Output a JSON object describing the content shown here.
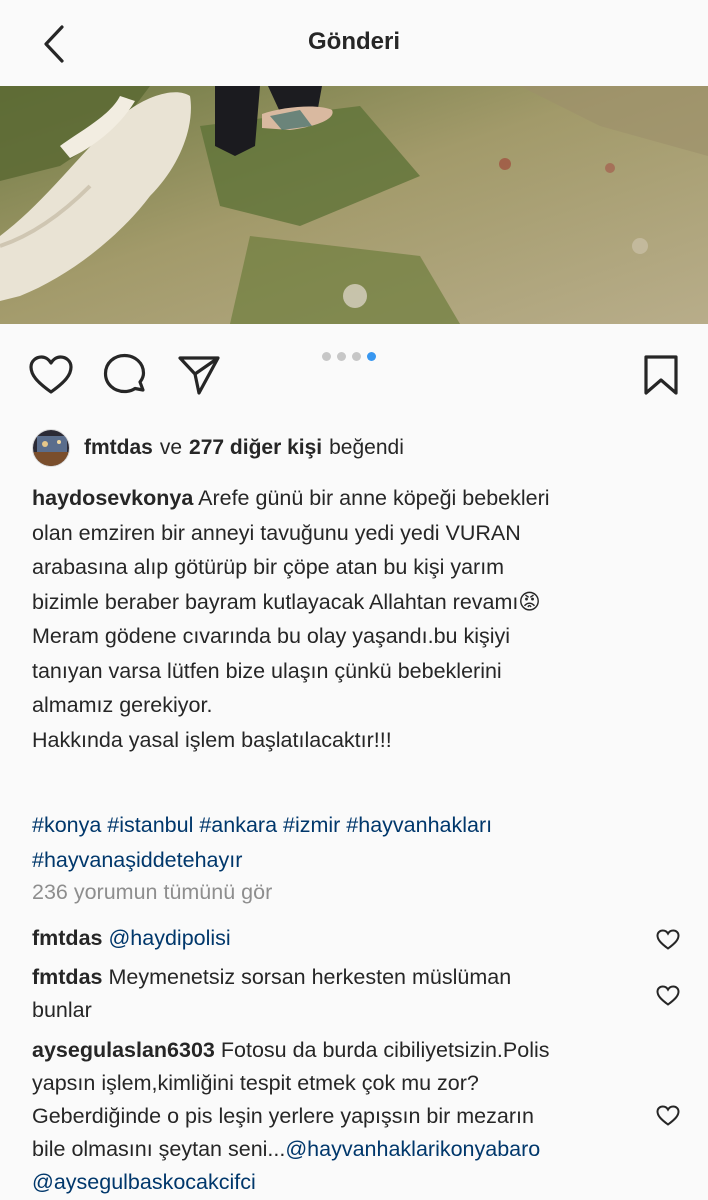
{
  "header": {
    "title": "Gönderi",
    "back_icon": "chevron-left-icon"
  },
  "post": {
    "carousel": {
      "total": 4,
      "active_index": 3
    },
    "actions": {
      "like_icon": "heart-icon",
      "comment_icon": "comment-icon",
      "share_icon": "paper-plane-icon",
      "save_icon": "bookmark-icon"
    },
    "likes": {
      "user": "fmtdas",
      "connector": "ve",
      "others": "277 diğer kişi",
      "suffix": "beğendi"
    },
    "caption": {
      "user": "haydosevkonya",
      "lines": [
        "Arefe günü bir anne köpeği bebekleri",
        "olan emziren bir anneyi tavuğunu yedi yedi VURAN",
        "arabasına alıp götürüp bir çöpe atan bu kişi yarım",
        "bizimle beraber bayram kutlayacak Allahtan revamı",
        "Meram gödene cıvarında bu olay yaşandı.bu kişiyi",
        "tanıyan varsa lütfen bize ulaşın çünkü bebeklerini",
        "almamız gerekiyor.",
        "Hakkında yasal işlem başlatılacaktır!!!"
      ],
      "emoji": "😡",
      "hashtags_line1": "#konya #istanbul #ankara #izmir #hayvanhakları",
      "hashtags_line2": "#hayvanaşiddetehayır"
    },
    "view_all_comments": "236 yorumun tümünü gör",
    "comments": [
      {
        "user": "fmtdas",
        "mention": "@haydipolisi"
      },
      {
        "user": "fmtdas",
        "text_l1": "Meymenetsiz sorsan herkesten müslüman",
        "text_l2": "bunlar"
      },
      {
        "user": "aysegulaslan6303",
        "text_l1": "Fotosu da burda cibiliyetsizin.Polis",
        "text_l2": "yapsın işlem,kimliğini tespit etmek çok mu zor?",
        "text_l3": "Geberdiğinde o pis leşin yerlere yapışsın bir mezarın",
        "text_l4": "bile olmasını şeytan seni...",
        "mention1": "@hayvanhaklarikonyabaro",
        "mention2": "@aysegulbaskocakcifci"
      }
    ]
  },
  "colors": {
    "link": "#00376b",
    "muted": "#8e8e8e",
    "active_dot": "#3897f0",
    "text": "#262626"
  }
}
